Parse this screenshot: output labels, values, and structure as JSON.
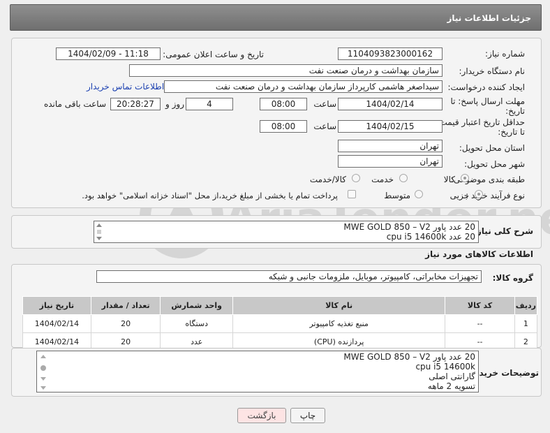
{
  "header": {
    "title": "جزئیات اطلاعات نیاز"
  },
  "form": {
    "need_number_label": "شماره نیاز:",
    "need_number": "1104093823000162",
    "announce_label": "تاریخ و ساعت اعلان عمومی:",
    "announce_value": "1404/02/09 - 11:18",
    "buyer_org_label": "نام دستگاه خریدار:",
    "buyer_org": "سازمان بهداشت و درمان صنعت نفت",
    "requester_label": "ایجاد کننده درخواست:",
    "requester": "سیداصغر هاشمی کارپرداز سازمان بهداشت و درمان صنعت نفت",
    "contact_link": "اطلاعات تماس خریدار",
    "deadline_label_1": "مهلت ارسال پاسخ: تا",
    "deadline_label_2": "تاریخ:",
    "deadline_date": "1404/02/14",
    "time_label": "ساعت",
    "deadline_time": "08:00",
    "days_value": "4",
    "days_label": "روز و",
    "remaining_time": "20:28:27",
    "remaining_label": "ساعت باقی مانده",
    "min_validity_label_1": "حداقل تاریخ اعتبار قیمت:",
    "min_validity_label_2": "تا تاریخ:",
    "validity_date": "1404/02/15",
    "validity_time": "08:00",
    "province_label": "استان محل تحویل:",
    "province": "تهران",
    "city_label": "شهر محل تحویل:",
    "city": "تهران",
    "category_label": "طبقه بندی موضوعی:",
    "category_options": [
      "کالا",
      "خدمت",
      "کالا/خدمت"
    ],
    "process_label": "نوع فرآیند خرید :",
    "process_options": [
      "جزیی",
      "متوسط"
    ],
    "payment_note": "پرداخت تمام یا بخشی از مبلغ خرید،از محل \"اسناد خزانه اسلامی\" خواهد بود."
  },
  "summary": {
    "label": "شرح کلی نیاز:",
    "lines": [
      "20 عدد پاور MWE GOLD 850 – V2",
      "20 عدد cpu i5 14600k"
    ]
  },
  "goods": {
    "section_title": "اطلاعات کالاهای مورد نیاز",
    "group_label": "گروه کالا:",
    "group_value": "تجهیزات مخابراتی، کامپیوتر، موبایل، ملزومات جانبی و شبکه"
  },
  "table": {
    "headers": [
      "ردیف",
      "کد کالا",
      "نام کالا",
      "واحد شمارش",
      "تعداد / مقدار",
      "تاریخ نیاز"
    ],
    "rows": [
      [
        "1",
        "--",
        "منبع تغذیه کامپیوتر",
        "دستگاه",
        "20",
        "1404/02/14"
      ],
      [
        "2",
        "--",
        "پردازنده (CPU)",
        "عدد",
        "20",
        "1404/02/14"
      ]
    ]
  },
  "buyer_notes": {
    "label": "توضیحات خریدار:",
    "lines": [
      "20 عدد پاور MWE GOLD 850 – V2",
      "cpu i5 14600k",
      "گارانتی اصلی",
      "تسویه 2 ماهه"
    ]
  },
  "buttons": {
    "print": "چاپ",
    "back": "بازگشت"
  },
  "watermark": {
    "text": "AriaTender.neT"
  }
}
